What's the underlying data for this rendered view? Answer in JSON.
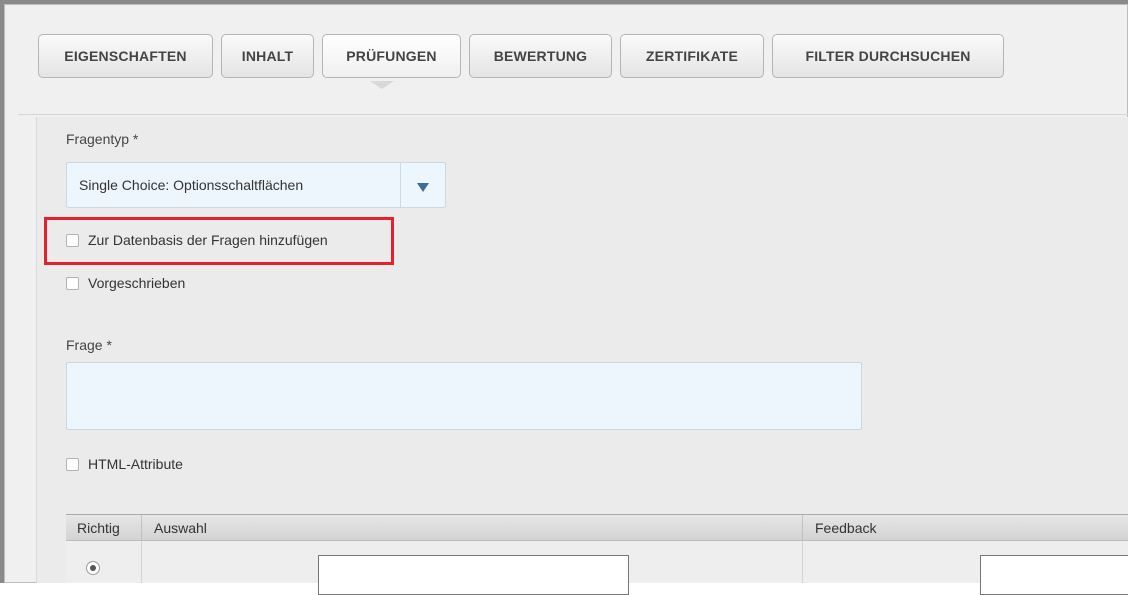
{
  "tabs": [
    {
      "label": "EIGENSCHAFTEN",
      "active": false
    },
    {
      "label": "INHALT",
      "active": false
    },
    {
      "label": "PRÜFUNGEN",
      "active": true
    },
    {
      "label": "BEWERTUNG",
      "active": false
    },
    {
      "label": "ZERTIFIKATE",
      "active": false
    },
    {
      "label": "FILTER DURCHSUCHEN",
      "active": false
    }
  ],
  "form": {
    "question_type_label": "Fragentyp *",
    "question_type_value": "Single Choice: Optionsschaltflächen",
    "add_to_database_label": "Zur Datenbasis der Fragen hinzufügen",
    "mandatory_label": "Vorgeschrieben",
    "question_label": "Frage *",
    "question_value": "",
    "html_attributes_label": "HTML-Attribute"
  },
  "answers_table": {
    "columns": [
      "Richtig",
      "Auswahl",
      "Feedback"
    ],
    "rows": [
      {
        "correct": true,
        "choice": "",
        "feedback": ""
      }
    ]
  },
  "colors": {
    "highlight": "#e5222b",
    "input_bg": "#eef6fd",
    "dropdown_arrow": "#3b6e95"
  }
}
